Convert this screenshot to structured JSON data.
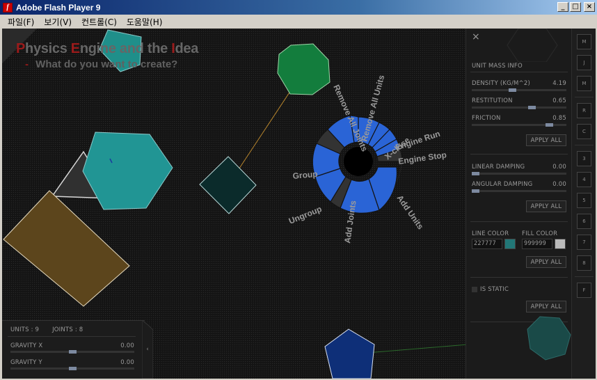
{
  "window": {
    "title": "Adobe Flash Player 9",
    "app_icon": "flash-icon",
    "controls": {
      "minimize": "_",
      "maximize": "□",
      "close": "×"
    }
  },
  "menu": [
    "파일(F)",
    "보기(V)",
    "컨트롤(C)",
    "도움말(H)"
  ],
  "headline": {
    "title_parts": [
      {
        "text": "P",
        "accent": true
      },
      {
        "text": "hysics ",
        "accent": false
      },
      {
        "text": "E",
        "accent": true
      },
      {
        "text": "ngine and the ",
        "accent": false
      },
      {
        "text": "I",
        "accent": true
      },
      {
        "text": "dea",
        "accent": false
      }
    ],
    "dash": "-",
    "subtitle": "What do you want to create?"
  },
  "radial_menu": {
    "labels": [
      "Remove All Joints",
      "Remove All Units",
      "X-close",
      "Engine Run",
      "Engine Stop",
      "Add Units",
      "Add Joints",
      "Ungroup",
      "Group"
    ],
    "accent": "#1f5fd6"
  },
  "props": {
    "close_icon": "×",
    "section_title": "UNIT MASS INFO",
    "density": {
      "label": "DENSITY (KG/M^2)",
      "value": "4.19",
      "level": 0.42
    },
    "restitution": {
      "label": "RESTITUTION",
      "value": "0.65",
      "level": 0.65
    },
    "friction": {
      "label": "FRICTION",
      "value": "0.85",
      "level": 0.85
    },
    "apply_label": "APPLY ALL",
    "linear_damping": {
      "label": "LINEAR DAMPING",
      "value": "0.00",
      "level": 0.0
    },
    "angular_damping": {
      "label": "ANGULAR DAMPING",
      "value": "0.00",
      "level": 0.0
    },
    "line_color": {
      "label": "LINE COLOR",
      "value": "227777",
      "swatch": "#227777"
    },
    "fill_color": {
      "label": "FILL COLOR",
      "value": "999999",
      "swatch": "#bbbbbb"
    },
    "is_static_label": "IS STATIC"
  },
  "tools": [
    "M",
    "J",
    "M",
    "R",
    "C",
    "3",
    "4",
    "5",
    "6",
    "7",
    "8",
    "F"
  ],
  "info": {
    "units": "UNITS : 9",
    "joints": "JOINTS : 8",
    "gravity_x": {
      "label": "GRAVITY X",
      "value": "0.00",
      "level": 0.5
    },
    "gravity_y": {
      "label": "GRAVITY Y",
      "value": "0.00",
      "level": 0.5
    },
    "collapse_icon": "‹"
  }
}
